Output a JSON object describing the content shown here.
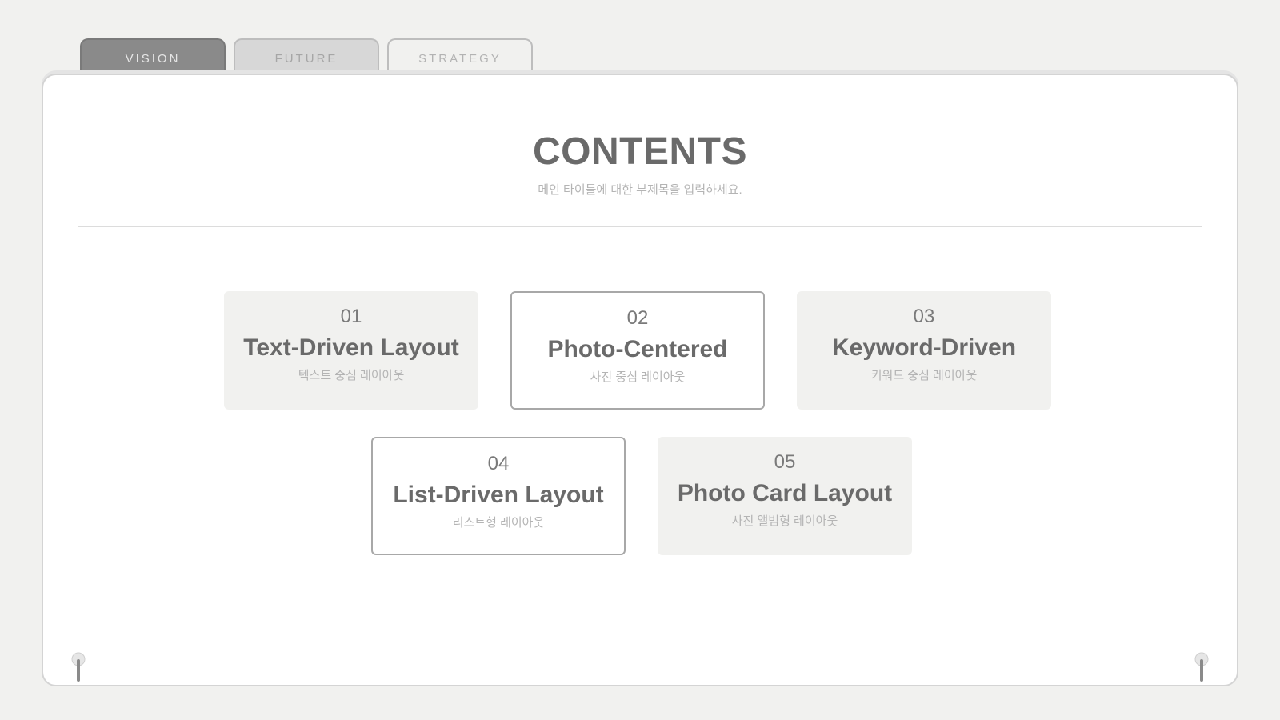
{
  "tabs": [
    {
      "label": "VISION"
    },
    {
      "label": "FUTURE"
    },
    {
      "label": "STRATEGY"
    }
  ],
  "header": {
    "title": "CONTENTS",
    "subtitle": "메인 타이틀에 대한 부제목을 입력하세요."
  },
  "cards": [
    {
      "number": "01",
      "title": "Text-Driven Layout",
      "subtitle": "텍스트 중심 레이아웃"
    },
    {
      "number": "02",
      "title": "Photo-Centered",
      "subtitle": "사진 중심 레이아웃"
    },
    {
      "number": "03",
      "title": "Keyword-Driven",
      "subtitle": "키워드 중심 레이아웃"
    },
    {
      "number": "04",
      "title": "List-Driven Layout",
      "subtitle": "리스트형 레이아웃"
    },
    {
      "number": "05",
      "title": "Photo Card Layout",
      "subtitle": "사진 앨범형 레이아웃"
    }
  ],
  "colors": {
    "background": "#f1f1ef",
    "panel": "#ffffff",
    "active_tab": "#8a8a8a",
    "text": "#6a6a6a",
    "muted": "#b4b4b4"
  },
  "icons": {
    "left_pin": "pin-icon",
    "right_pin": "pin-icon"
  }
}
